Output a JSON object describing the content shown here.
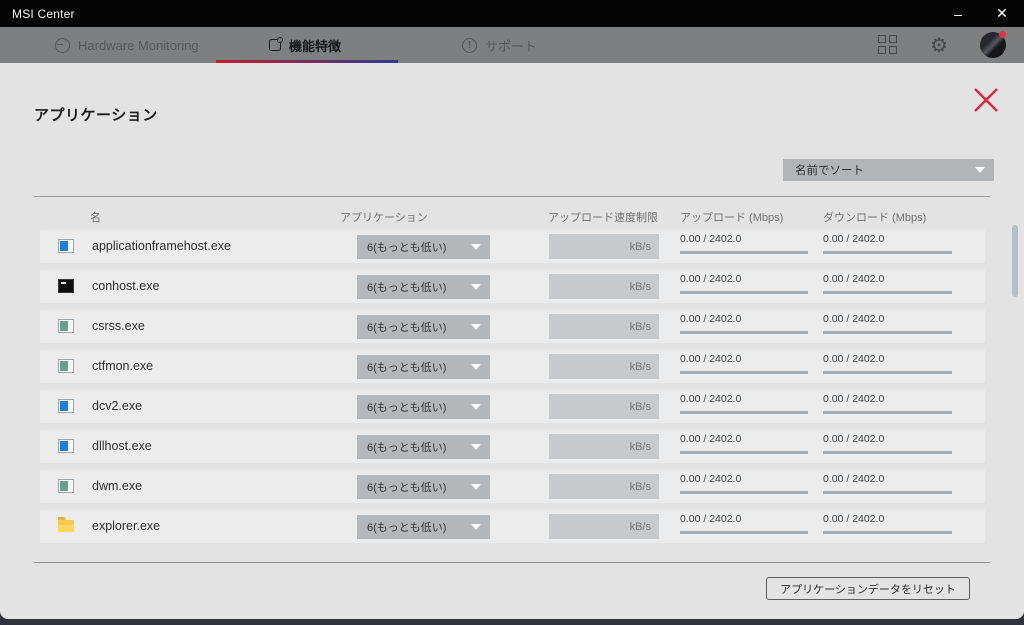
{
  "window": {
    "title": "MSI Center"
  },
  "icons": {
    "minimize_glyph": "–",
    "close_glyph": "✕",
    "gear_glyph": "⚙",
    "support_glyph": "!"
  },
  "nav": {
    "tabs": [
      {
        "label": "Hardware Monitoring",
        "icon": "gauge-icon",
        "active": false
      },
      {
        "label": "機能特徴",
        "icon": "feature-icon",
        "active": true
      },
      {
        "label": "サポート",
        "icon": "support-icon",
        "active": false
      }
    ]
  },
  "panel": {
    "title": "アプリケーション",
    "sort": {
      "value": "名前でソート"
    },
    "table": {
      "columns": [
        "名",
        "アプリケーション",
        "アップロード速度制限",
        "アップロード (Mbps)",
        "ダウンロード (Mbps)"
      ],
      "rows": [
        {
          "name": "applicationframehost.exe",
          "icon": "window-blue",
          "priority": "6(もっとも低い)",
          "limit_value": "",
          "limit_unit": "kB/s",
          "upload": "0.00 / 2402.0",
          "download": "0.00 / 2402.0"
        },
        {
          "name": "conhost.exe",
          "icon": "console",
          "priority": "6(もっとも低い)",
          "limit_value": "",
          "limit_unit": "kB/s",
          "upload": "0.00 / 2402.0",
          "download": "0.00 / 2402.0"
        },
        {
          "name": "csrss.exe",
          "icon": "window-teal",
          "priority": "6(もっとも低い)",
          "limit_value": "",
          "limit_unit": "kB/s",
          "upload": "0.00 / 2402.0",
          "download": "0.00 / 2402.0"
        },
        {
          "name": "ctfmon.exe",
          "icon": "window-teal",
          "priority": "6(もっとも低い)",
          "limit_value": "",
          "limit_unit": "kB/s",
          "upload": "0.00 / 2402.0",
          "download": "0.00 / 2402.0"
        },
        {
          "name": "dcv2.exe",
          "icon": "window-blue",
          "priority": "6(もっとも低い)",
          "limit_value": "",
          "limit_unit": "kB/s",
          "upload": "0.00 / 2402.0",
          "download": "0.00 / 2402.0"
        },
        {
          "name": "dllhost.exe",
          "icon": "window-blue",
          "priority": "6(もっとも低い)",
          "limit_value": "",
          "limit_unit": "kB/s",
          "upload": "0.00 / 2402.0",
          "download": "0.00 / 2402.0"
        },
        {
          "name": "dwm.exe",
          "icon": "window-teal",
          "priority": "6(もっとも低い)",
          "limit_value": "",
          "limit_unit": "kB/s",
          "upload": "0.00 / 2402.0",
          "download": "0.00 / 2402.0"
        },
        {
          "name": "explorer.exe",
          "icon": "folder",
          "priority": "6(もっとも低い)",
          "limit_value": "",
          "limit_unit": "kB/s",
          "upload": "0.00 / 2402.0",
          "download": "0.00 / 2402.0"
        }
      ]
    },
    "reset_button_label": "アプリケーションデータをリセット"
  },
  "colors": {
    "accent_red": "#d9293d",
    "underline_gradient_from": "#c41e2e",
    "underline_gradient_to": "#2c3a8c",
    "navbar_bg": "#7e7f80",
    "panel_bg": "#e3e3e3",
    "row_bg": "#ececec",
    "control_bg": "#b4b8bb"
  }
}
